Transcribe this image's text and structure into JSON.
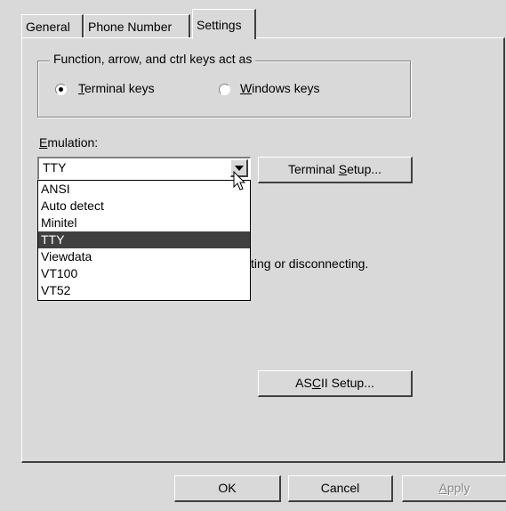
{
  "tabs": [
    {
      "label": "General"
    },
    {
      "label": "Phone Number"
    },
    {
      "label": "Settings"
    }
  ],
  "group": {
    "legend": "Function, arrow, and ctrl keys act as",
    "radio_terminal": {
      "underline": "T",
      "rest": "erminal keys",
      "selected": true
    },
    "radio_windows": {
      "underline": "W",
      "rest": "indows keys",
      "selected": false
    }
  },
  "emulation": {
    "label_underline": "E",
    "label_rest": "mulation:",
    "selected_value": "TTY",
    "options": [
      "ANSI",
      "Auto detect",
      "Minitel",
      "TTY",
      "Viewdata",
      "VT100",
      "VT52"
    ],
    "selected_index": 3
  },
  "buttons": {
    "terminal_setup": {
      "pre": "Terminal ",
      "underline": "S",
      "post": "etup..."
    },
    "ascii_setup": {
      "pre": "AS",
      "underline": "C",
      "post": "II Setup..."
    },
    "ok": "OK",
    "cancel": "Cancel",
    "apply_underline": "A",
    "apply_rest": "pply"
  },
  "hidden_text": "ting or disconnecting.",
  "colors": {
    "face": "#d9d9d9",
    "selection": "#404040"
  }
}
